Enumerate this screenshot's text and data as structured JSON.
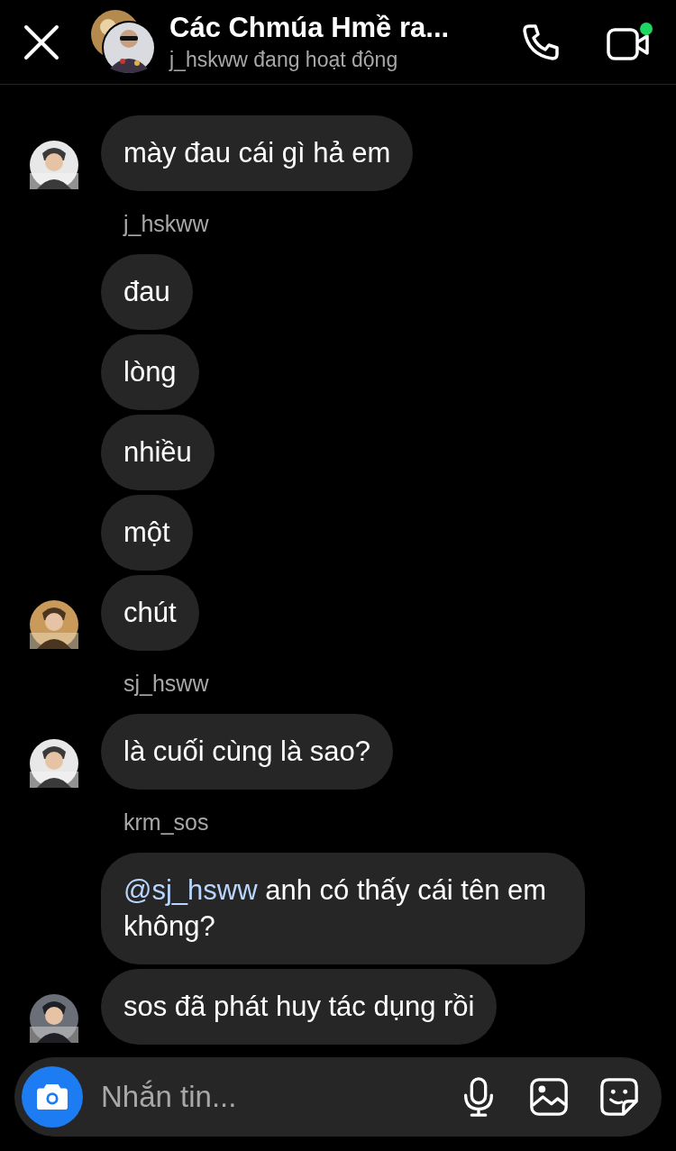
{
  "header": {
    "title": "Các Chmúa Hmề ra...",
    "status": "j_hskww đang hoạt động",
    "online": true
  },
  "groups": [
    {
      "avatar": {
        "kind": "picture"
      },
      "messages": [
        {
          "text": "mày đau cái gì hả em"
        }
      ]
    },
    {
      "sender": "j_hskww",
      "avatar": {
        "kind": "picture"
      },
      "messages": [
        {
          "text": "đau"
        },
        {
          "text": "lòng"
        },
        {
          "text": "nhiều"
        },
        {
          "text": "một"
        },
        {
          "text": "chút"
        }
      ]
    },
    {
      "sender": "sj_hsww",
      "avatar": {
        "kind": "picture"
      },
      "messages": [
        {
          "text": "là cuối cùng là sao?"
        }
      ]
    },
    {
      "sender": "krm_sos",
      "avatar": {
        "kind": "picture"
      },
      "messages": [
        {
          "mention": "@sj_hsww",
          "text": " anh có thấy cái tên em không?"
        },
        {
          "text": "sos đã phát huy tác dụng rồi"
        }
      ]
    }
  ],
  "composer": {
    "placeholder": "Nhắn tin..."
  }
}
